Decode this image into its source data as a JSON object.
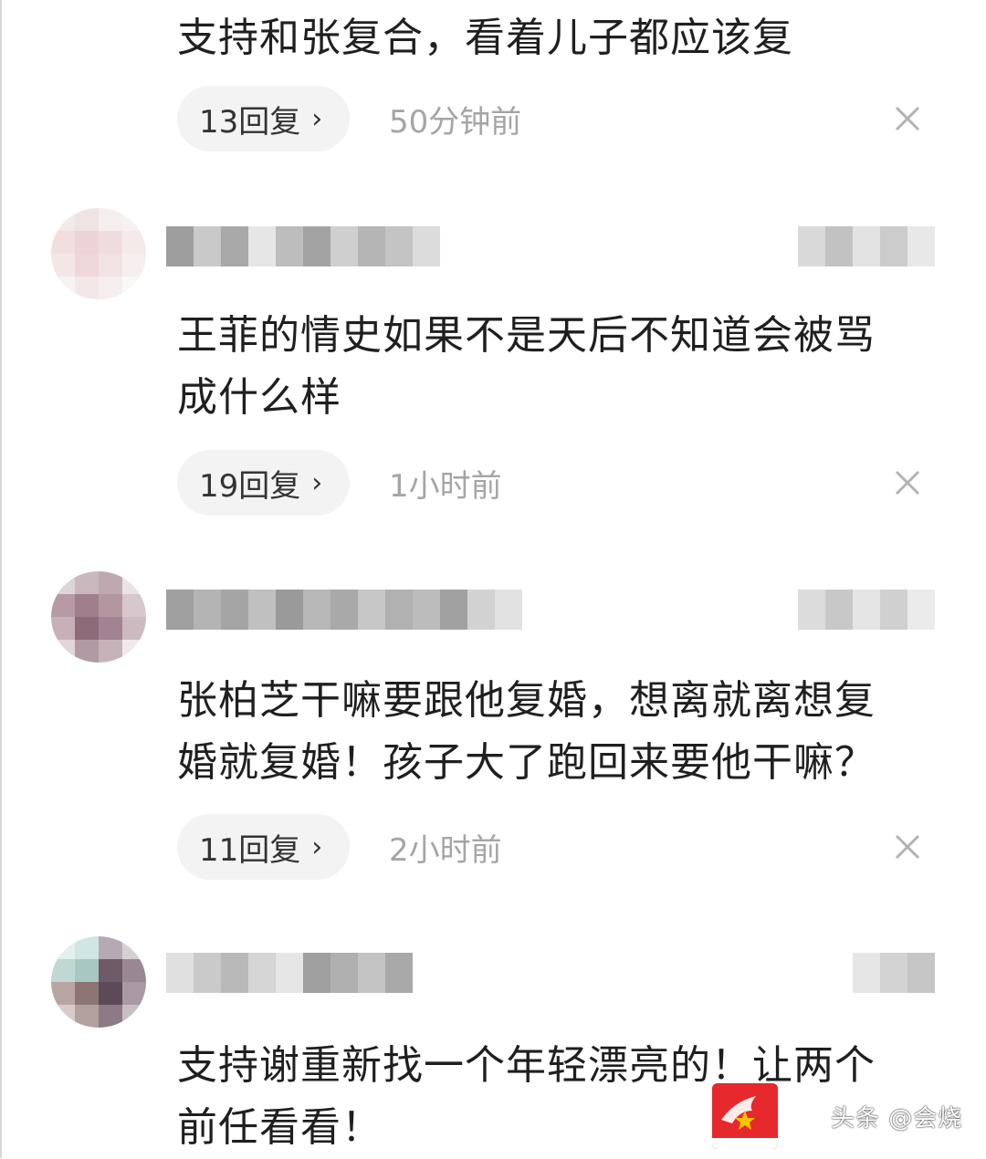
{
  "comments": [
    {
      "text": "支持和张复合，看着儿子都应该复",
      "reply_label": "13回复",
      "time": "50分钟前"
    },
    {
      "text": "王菲的情史如果不是天后不知道会被骂\n成什么样",
      "reply_label": "19回复",
      "time": "1小时前"
    },
    {
      "text": "张柏芝干嘛要跟他复婚，想离就离想复\n婚就复婚！孩子大了跑回来要他干嘛？",
      "reply_label": "11回复",
      "time": "2小时前"
    },
    {
      "text": "支持谢重新找一个年轻漂亮的！让两个\n前任看看！"
    }
  ],
  "icons": {
    "chevron": "›",
    "close": "close-icon",
    "reply_chevron": "chevron-right-icon"
  },
  "watermark": {
    "text": "头条 @会烧"
  },
  "colors": {
    "pill_bg": "#f3f3f3",
    "time_text": "#a5a5a5",
    "body_text": "#1f1f1f",
    "brand_red": "#e7282d"
  }
}
